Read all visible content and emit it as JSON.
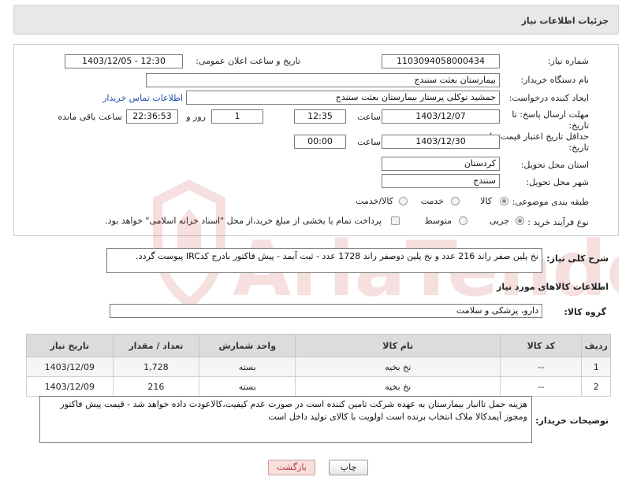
{
  "header": {
    "title": "جزئیات اطلاعات نیاز"
  },
  "form": {
    "need_number_label": "شماره نیاز:",
    "need_number": "1103094058000434",
    "announce_label": "تاریخ و ساعت اعلان عمومی:",
    "announce_value": "1403/12/05 - 12:30",
    "buyer_org_label": "نام دستگاه خریدار:",
    "buyer_org": "بیمارستان بعثت سنندج",
    "requester_label": "ایجاد کننده درخواست:",
    "requester": "جمشید  توکلی پرستار بیمارستان بعثت سنندج",
    "contact_link": "اطلاعات تماس خریدار",
    "deadline_label": "مهلت ارسال پاسخ: تا تاریخ:",
    "deadline_date": "1403/12/07",
    "time_label": "ساعت",
    "deadline_time": "12:35",
    "days": "1",
    "days_label": "روز و",
    "remaining": "22:36:53",
    "remaining_label": "ساعت باقی مانده",
    "validity_label": "حداقل تاریخ اعتبار قیمت: تا تاریخ:",
    "validity_date": "1403/12/30",
    "validity_time": "00:00",
    "province_label": "استان محل تحویل:",
    "province": "کردستان",
    "city_label": "شهر محل تحویل:",
    "city": "سنندج",
    "category_label": "طبقه بندی موضوعی:",
    "category_options": [
      "کالا",
      "خدمت",
      "کالا/خدمت"
    ],
    "process_label": "نوع فرآیند خرید :",
    "process_options": [
      "جزیی",
      "متوسط"
    ],
    "treasury_text": "پرداخت تمام یا بخشی از مبلغ خرید،از محل \"اسناد خزانه اسلامی\" خواهد بود."
  },
  "summary": {
    "label": "شرح کلی نیاز:",
    "text": "نخ پلین صفر راند 216 عدد و نخ پلین دوصفر راند 1728 عدد - ثبت آیمد - پیش فاکتور بادرج کدIRC پیوست گردد."
  },
  "goods": {
    "section_title": "اطلاعات کالاهای مورد نیاز",
    "group_label": "گروه کالا:",
    "group_value": "دارو، پزشکی و سلامت",
    "table": {
      "headers": [
        "ردیف",
        "کد کالا",
        "نام کالا",
        "واحد شمارش",
        "تعداد / مقدار",
        "تاریخ نیاز"
      ],
      "rows": [
        [
          "1",
          "--",
          "نخ بخیه",
          "بسته",
          "1,728",
          "1403/12/09"
        ],
        [
          "2",
          "--",
          "نخ بخیه",
          "بسته",
          "216",
          "1403/12/09"
        ]
      ]
    }
  },
  "buyer_notes": {
    "label": "توضیحات خریدار:",
    "text": "هزینه حمل تاانبار بیمارستان به عهده شرکت تامین کننده است در صورت عدم کیفیت،کالاعودت داده خواهد شد - قیمت پیش فاکتور ومجوز آیمدکالا ملاک انتخاب برنده است اولویت با کالای تولید داخل است"
  },
  "buttons": {
    "print": "چاپ",
    "back": "بازگشت"
  },
  "watermark": {
    "brand": "AriaTender.net"
  },
  "colors": {
    "link": "#1f4fa5",
    "back_button": "#f9dede",
    "table_header": "#dcdcdc"
  }
}
